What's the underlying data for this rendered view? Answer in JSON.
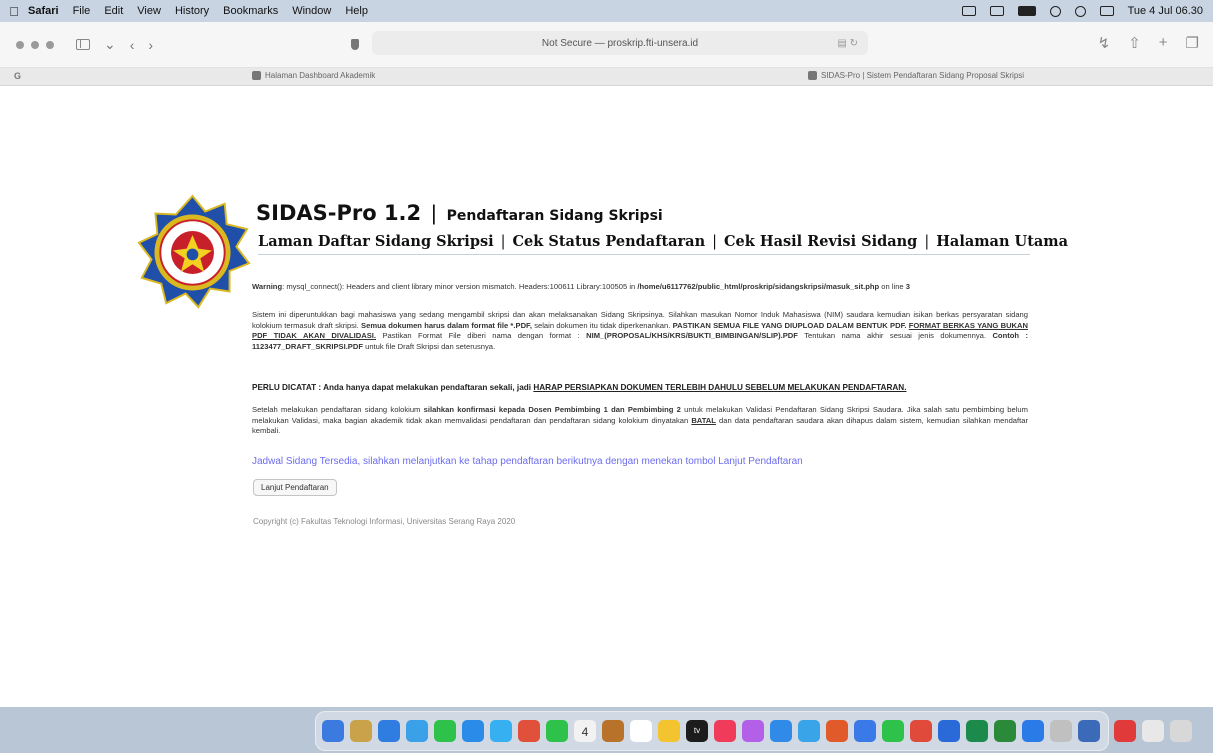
{
  "menubar": {
    "items": [
      "Safari",
      "File",
      "Edit",
      "View",
      "History",
      "Bookmarks",
      "Window",
      "Help"
    ],
    "clock": "Tue 4 Jul 06.30"
  },
  "toolbar": {
    "url": "Not Secure — proskrip.fti-unsera.id"
  },
  "tabs": {
    "group_label": "G",
    "tab1": "Halaman Dashboard Akademik",
    "tab2": "SIDAS-Pro | Sistem Pendaftaran Sidang Proposal Skripsi"
  },
  "page": {
    "title": "SIDAS-Pro 1.2",
    "title_separator": "|",
    "subtitle": "Pendaftaran Sidang Skripsi",
    "nav": [
      "Laman Daftar Sidang Skripsi",
      "Cek Status Pendaftaran",
      "Cek Hasil Revisi Sidang",
      "Halaman Utama"
    ],
    "nav_separator": "|",
    "warning_label": "Warning",
    "warning_text": ": mysql_connect(): Headers and client library minor version mismatch. Headers:100611 Library:100505 in ",
    "warning_path": "/home/u6117762/public_html/proskrip/sidangskripsi/masuk_sit.php",
    "warning_line_text": " on line ",
    "warning_line_num": "3",
    "para1_a": "Sistem ini diperuntukkan bagi mahasiswa yang sedang mengambil skripsi dan akan melaksanakan Sidang Skripsinya. Silahkan masukan Nomor Induk Mahasiswa (NIM) saudara kemudian isikan berkas persyaratan sidang kolokium termasuk draft skripsi. ",
    "para1_b": "Semua dokumen harus dalam format file *.PDF,",
    "para1_c": " selain dokumen itu tidak diperkenankan. ",
    "para1_d": "PASTIKAN SEMUA FILE YANG DIUPLOAD DALAM BENTUK PDF. ",
    "para1_e": "FORMAT BERKAS YANG BUKAN PDF TIDAK AKAN DIVALIDASI.",
    "para1_f": " Pastikan Format File diberi nama dengan format : ",
    "para1_g": "NIM_(PROPOSAL/KHS/KRS/BUKTI_BIMBINGAN/SLIP).PDF",
    "para1_h": " Tentukan nama akhir sesuai jenis dokumennya. ",
    "para1_i": "Contoh : 1123477_DRAFT_SKRIPSI.PDF",
    "para1_j": " untuk file Draft Skripsi dan seterusnya.",
    "para2_a": "PERLU DICATAT : Anda hanya dapat melakukan pendaftaran sekali, jadi ",
    "para2_b": "HARAP PERSIAPKAN DOKUMEN TERLEBIH DAHULU SEBELUM MELAKUKAN PENDAFTARAN.",
    "para3_a": "Setelah melakukan pendaftaran sidang kolokium ",
    "para3_b": "silahkan konfirmasi kepada Dosen Pembimbing 1 dan Pembimbing 2",
    "para3_c": " untuk melakukan Validasi Pendaftaran Sidang Skripsi Saudara. Jika salah satu pembimbing belum melakukan Validasi, maka bagian akademik tidak akan memvalidasi pendaftaran dan pendaftaran sidang kolokium dinyatakan ",
    "para3_d": "BATAL",
    "para3_e": " dan data pendaftaran saudara akan dihapus dalam sistem, kemudian silahkan mendaftar kembali.",
    "jadwal": "Jadwal Sidang Tersedia, silahkan melanjutkan ke tahap pendaftaran berikutnya dengan menekan tombol Lanjut Pendaftaran",
    "button_lanjut": "Lanjut Pendaftaran",
    "copyright": "Copyright (c) Fakultas Teknologi Informasi, Universitas Serang Raya 2020"
  },
  "dock": {
    "calendar_day": "4",
    "tv_label": "tv",
    "icon_colors": [
      "#3b7be0",
      "#c9a24a",
      "#2f7de1",
      "#3aa0e8",
      "#2ec24a",
      "#2a8be8",
      "#36b0f0",
      "#e0503a",
      "#2ec24a",
      "#f2f2f2",
      "#b8722a",
      "#ffffff",
      "#f4c430",
      "#1c1c1c",
      "#f03c5a",
      "#b45fe8",
      "#2f8ae8",
      "#3aa4e8",
      "#e05a2a",
      "#3a7ae8",
      "#2ec24a",
      "#e04a3a",
      "#2a6ad8",
      "#1c8a4a",
      "#2a8a3a",
      "#2a7ae8",
      "#c0c0c0",
      "#3a6ab8",
      "#e03a3a",
      "#e8e8e8",
      "#d8d8d8"
    ]
  }
}
